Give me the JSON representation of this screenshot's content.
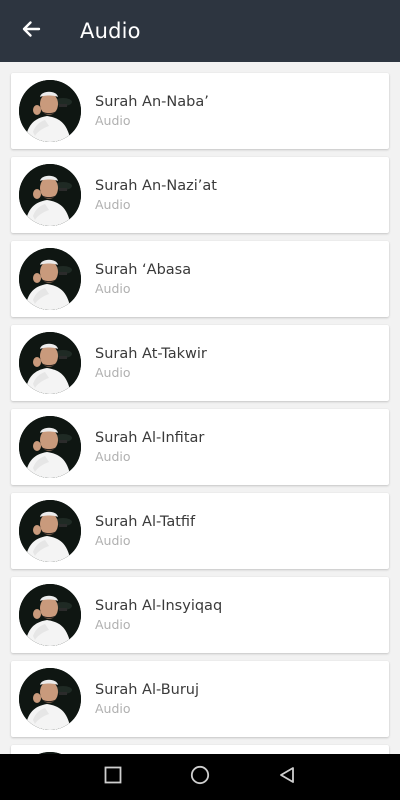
{
  "app_bar": {
    "title": "Audio",
    "back_icon": "arrow-left-icon"
  },
  "colors": {
    "app_bar_bg": "#2d3540",
    "background": "#f2f2f2",
    "card_bg": "#ffffff",
    "title_text": "#3a3a3a",
    "subtitle_text": "#b0b0b0",
    "nav_bar_bg": "#000000"
  },
  "items": [
    {
      "title": "Surah An-Naba’",
      "subtitle": "Audio"
    },
    {
      "title": "Surah An-Nazi’at",
      "subtitle": "Audio"
    },
    {
      "title": "Surah ‘Abasa",
      "subtitle": "Audio"
    },
    {
      "title": "Surah At-Takwir",
      "subtitle": "Audio"
    },
    {
      "title": "Surah Al-Infitar",
      "subtitle": "Audio"
    },
    {
      "title": "Surah Al-Tatfif",
      "subtitle": "Audio"
    },
    {
      "title": "Surah Al-Insyiqaq",
      "subtitle": "Audio"
    },
    {
      "title": "Surah Al-Buruj",
      "subtitle": "Audio"
    },
    {
      "title": "",
      "subtitle": ""
    }
  ],
  "nav_bar": {
    "recents_icon": "square-icon",
    "home_icon": "circle-icon",
    "back_icon": "triangle-back-icon"
  }
}
